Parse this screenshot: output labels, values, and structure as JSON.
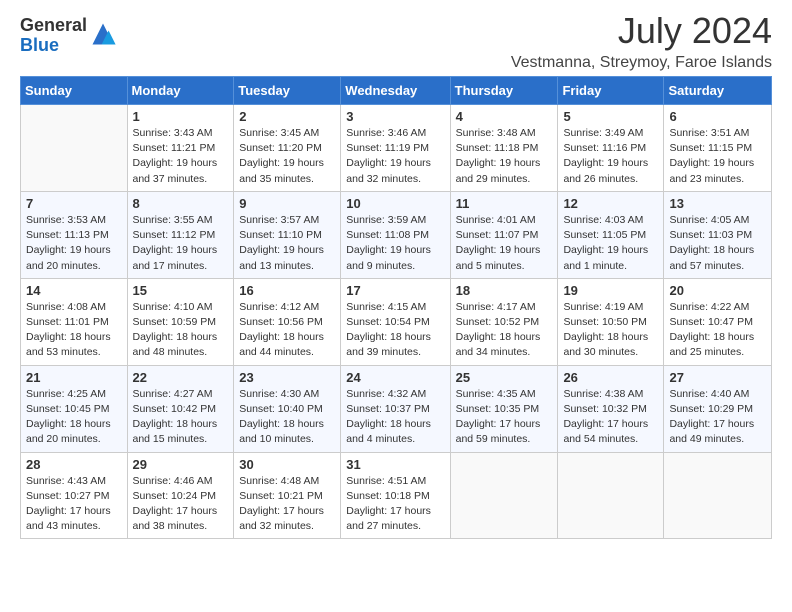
{
  "logo": {
    "general": "General",
    "blue": "Blue"
  },
  "title": {
    "month_year": "July 2024",
    "location": "Vestmanna, Streymoy, Faroe Islands"
  },
  "weekdays": [
    "Sunday",
    "Monday",
    "Tuesday",
    "Wednesday",
    "Thursday",
    "Friday",
    "Saturday"
  ],
  "weeks": [
    [
      {
        "day": "",
        "info": ""
      },
      {
        "day": "1",
        "info": "Sunrise: 3:43 AM\nSunset: 11:21 PM\nDaylight: 19 hours and 37 minutes."
      },
      {
        "day": "2",
        "info": "Sunrise: 3:45 AM\nSunset: 11:20 PM\nDaylight: 19 hours and 35 minutes."
      },
      {
        "day": "3",
        "info": "Sunrise: 3:46 AM\nSunset: 11:19 PM\nDaylight: 19 hours and 32 minutes."
      },
      {
        "day": "4",
        "info": "Sunrise: 3:48 AM\nSunset: 11:18 PM\nDaylight: 19 hours and 29 minutes."
      },
      {
        "day": "5",
        "info": "Sunrise: 3:49 AM\nSunset: 11:16 PM\nDaylight: 19 hours and 26 minutes."
      },
      {
        "day": "6",
        "info": "Sunrise: 3:51 AM\nSunset: 11:15 PM\nDaylight: 19 hours and 23 minutes."
      }
    ],
    [
      {
        "day": "7",
        "info": "Sunrise: 3:53 AM\nSunset: 11:13 PM\nDaylight: 19 hours and 20 minutes."
      },
      {
        "day": "8",
        "info": "Sunrise: 3:55 AM\nSunset: 11:12 PM\nDaylight: 19 hours and 17 minutes."
      },
      {
        "day": "9",
        "info": "Sunrise: 3:57 AM\nSunset: 11:10 PM\nDaylight: 19 hours and 13 minutes."
      },
      {
        "day": "10",
        "info": "Sunrise: 3:59 AM\nSunset: 11:08 PM\nDaylight: 19 hours and 9 minutes."
      },
      {
        "day": "11",
        "info": "Sunrise: 4:01 AM\nSunset: 11:07 PM\nDaylight: 19 hours and 5 minutes."
      },
      {
        "day": "12",
        "info": "Sunrise: 4:03 AM\nSunset: 11:05 PM\nDaylight: 19 hours and 1 minute."
      },
      {
        "day": "13",
        "info": "Sunrise: 4:05 AM\nSunset: 11:03 PM\nDaylight: 18 hours and 57 minutes."
      }
    ],
    [
      {
        "day": "14",
        "info": "Sunrise: 4:08 AM\nSunset: 11:01 PM\nDaylight: 18 hours and 53 minutes."
      },
      {
        "day": "15",
        "info": "Sunrise: 4:10 AM\nSunset: 10:59 PM\nDaylight: 18 hours and 48 minutes."
      },
      {
        "day": "16",
        "info": "Sunrise: 4:12 AM\nSunset: 10:56 PM\nDaylight: 18 hours and 44 minutes."
      },
      {
        "day": "17",
        "info": "Sunrise: 4:15 AM\nSunset: 10:54 PM\nDaylight: 18 hours and 39 minutes."
      },
      {
        "day": "18",
        "info": "Sunrise: 4:17 AM\nSunset: 10:52 PM\nDaylight: 18 hours and 34 minutes."
      },
      {
        "day": "19",
        "info": "Sunrise: 4:19 AM\nSunset: 10:50 PM\nDaylight: 18 hours and 30 minutes."
      },
      {
        "day": "20",
        "info": "Sunrise: 4:22 AM\nSunset: 10:47 PM\nDaylight: 18 hours and 25 minutes."
      }
    ],
    [
      {
        "day": "21",
        "info": "Sunrise: 4:25 AM\nSunset: 10:45 PM\nDaylight: 18 hours and 20 minutes."
      },
      {
        "day": "22",
        "info": "Sunrise: 4:27 AM\nSunset: 10:42 PM\nDaylight: 18 hours and 15 minutes."
      },
      {
        "day": "23",
        "info": "Sunrise: 4:30 AM\nSunset: 10:40 PM\nDaylight: 18 hours and 10 minutes."
      },
      {
        "day": "24",
        "info": "Sunrise: 4:32 AM\nSunset: 10:37 PM\nDaylight: 18 hours and 4 minutes."
      },
      {
        "day": "25",
        "info": "Sunrise: 4:35 AM\nSunset: 10:35 PM\nDaylight: 17 hours and 59 minutes."
      },
      {
        "day": "26",
        "info": "Sunrise: 4:38 AM\nSunset: 10:32 PM\nDaylight: 17 hours and 54 minutes."
      },
      {
        "day": "27",
        "info": "Sunrise: 4:40 AM\nSunset: 10:29 PM\nDaylight: 17 hours and 49 minutes."
      }
    ],
    [
      {
        "day": "28",
        "info": "Sunrise: 4:43 AM\nSunset: 10:27 PM\nDaylight: 17 hours and 43 minutes."
      },
      {
        "day": "29",
        "info": "Sunrise: 4:46 AM\nSunset: 10:24 PM\nDaylight: 17 hours and 38 minutes."
      },
      {
        "day": "30",
        "info": "Sunrise: 4:48 AM\nSunset: 10:21 PM\nDaylight: 17 hours and 32 minutes."
      },
      {
        "day": "31",
        "info": "Sunrise: 4:51 AM\nSunset: 10:18 PM\nDaylight: 17 hours and 27 minutes."
      },
      {
        "day": "",
        "info": ""
      },
      {
        "day": "",
        "info": ""
      },
      {
        "day": "",
        "info": ""
      }
    ]
  ]
}
